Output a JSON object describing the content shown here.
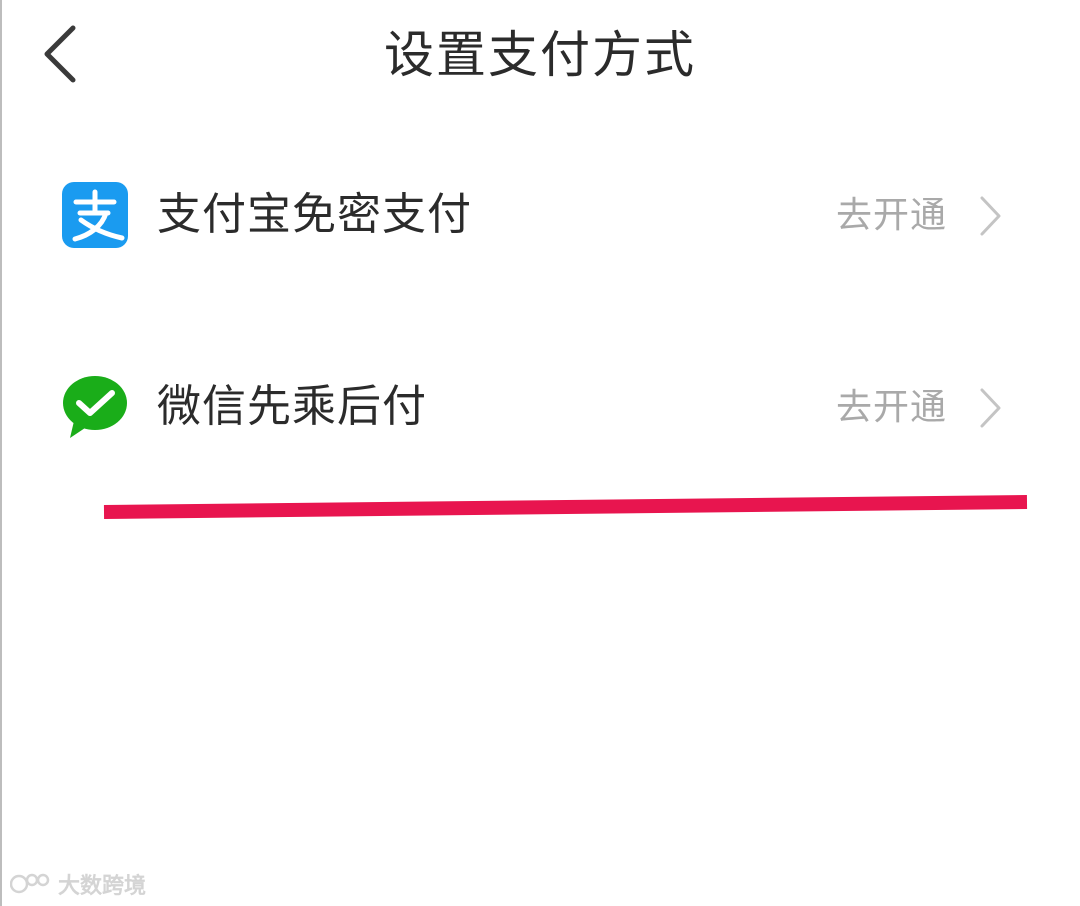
{
  "header": {
    "title": "设置支付方式",
    "back_icon": "chevron-left-icon"
  },
  "payment_options": [
    {
      "label": "支付宝免密支付",
      "action": "去开通",
      "icon": "alipay-logo",
      "icon_color": "#1a9bf0"
    },
    {
      "label": "微信先乘后付",
      "action": "去开通",
      "icon": "wechat-pay-logo",
      "icon_color": "#1aad19"
    }
  ],
  "annotation": {
    "color": "#e8154f"
  },
  "watermark": {
    "text": "大数跨境"
  }
}
